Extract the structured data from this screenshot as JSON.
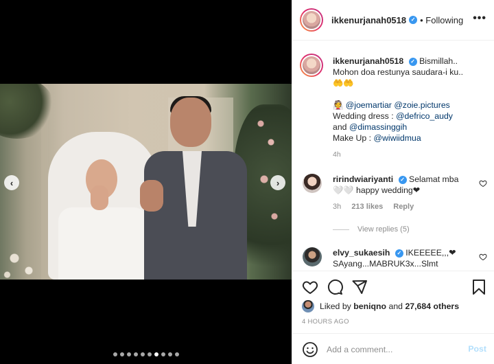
{
  "post": {
    "username": "ikkenurjanah0518",
    "verified_mark": "✓",
    "follow_status": "• Following",
    "more_menu": "•••"
  },
  "media": {
    "prev_arrow": "‹",
    "next_arrow": "›",
    "carousel_dots": 10,
    "active_dot": 6
  },
  "caption": {
    "username": "ikkenurjanah0518",
    "line1": "Bismillah..",
    "line2": "Mohon doa restunya saudara-i ku..",
    "line3": "🤲🤲",
    "line4_emoji": "👰",
    "mention_1": "@joemartiar",
    "mention_2": "@zoie.pictures",
    "wedding_dress_label": "Wedding dress :",
    "mention_3": "@defrico_audy",
    "and_label": "and",
    "mention_4": "@dimassinggih",
    "makeup_label": "Make Up :",
    "mention_5": "@wiwiidmua",
    "time": "4h"
  },
  "comments": [
    {
      "username": "ririndwiariyanti",
      "verified_mark": "✓",
      "text_1": "Selamat mba",
      "text_2": "🤍🤍 happy wedding❤",
      "time": "3h",
      "likes": "213 likes",
      "reply": "Reply"
    },
    {
      "username": "elvy_sukaesih",
      "verified_mark": "✓",
      "text_1": "IKEEEEE,,,❤",
      "text_2": "SAyang...MABRUK3x...Slmt"
    }
  ],
  "view_replies": "View replies (5)",
  "likes": {
    "prefix": "Liked by",
    "user": "beniqno",
    "suffix": "and",
    "others": "27,684 others"
  },
  "post_time": "4 HOURS AGO",
  "add_comment": {
    "placeholder": "Add a comment...",
    "post_label": "Post"
  },
  "colors": {
    "accent_blue": "#3897f0",
    "mention": "#00376b",
    "muted": "#8e8e8e",
    "post_disabled": "#b2dffc"
  }
}
